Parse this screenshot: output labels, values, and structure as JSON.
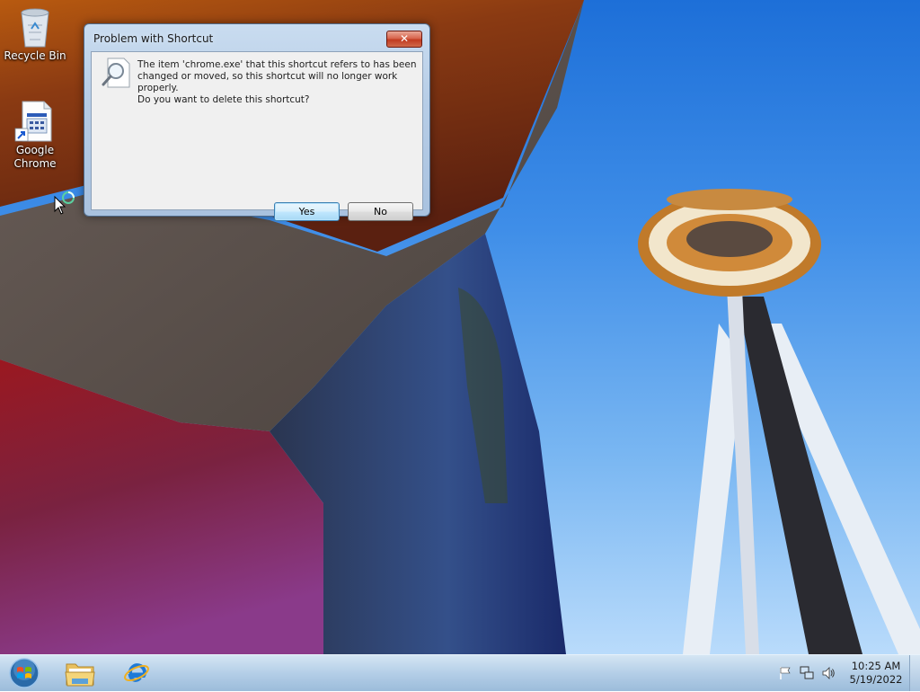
{
  "desktop": {
    "icons": [
      {
        "label": "Recycle Bin"
      },
      {
        "label_line1": "Google",
        "label_line2": "Chrome"
      }
    ]
  },
  "dialog": {
    "title": "Problem with Shortcut",
    "close_label": "✕",
    "message": "The item 'chrome.exe' that this shortcut refers to has been changed or moved, so this shortcut will no longer work properly.",
    "question": "Do you want to delete this shortcut?",
    "yes_label": "Yes",
    "no_label": "No"
  },
  "taskbar": {
    "pinned": [
      "folder-icon",
      "internet-explorer-icon"
    ],
    "tray_icons": [
      "action-center-flag-icon",
      "network-icon",
      "volume-icon"
    ],
    "clock_time": "10:25 AM",
    "clock_date": "5/19/2022"
  },
  "colors": {
    "sky": "#3f8ee8",
    "dialog_frame": "#b7cde6",
    "close_button": "#c13b20",
    "taskbar": "#b0cce6"
  }
}
